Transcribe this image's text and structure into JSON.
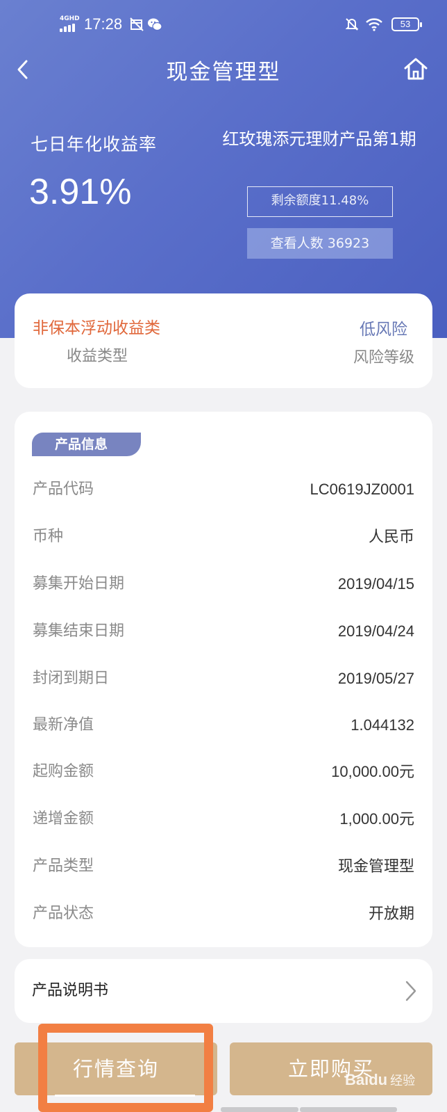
{
  "status_bar": {
    "network": "4GHD",
    "time": "17:28",
    "battery": "53",
    "icons": [
      "signal-icon",
      "calendar-off-icon",
      "wechat-icon",
      "mute-icon",
      "wifi-icon",
      "battery-icon"
    ]
  },
  "nav": {
    "title": "现金管理型",
    "back_icon": "back-chevron-icon",
    "home_icon": "home-icon"
  },
  "hero": {
    "rate_label": "七日年化收益率",
    "rate_value": "3.91%",
    "product_name": "红玫瑰添元理财产品第1期",
    "quota": "剩余额度11.48%",
    "viewers": "查看人数 36923"
  },
  "risk_card": {
    "return_type": "非保本浮动收益类",
    "return_type_label": "收益类型",
    "risk_level": "低风险",
    "risk_level_label": "风险等级"
  },
  "info_card": {
    "tab": "产品信息",
    "rows": [
      {
        "k": "产品代码",
        "v": "LC0619JZ0001"
      },
      {
        "k": "币种",
        "v": "人民币"
      },
      {
        "k": "募集开始日期",
        "v": "2019/04/15"
      },
      {
        "k": "募集结束日期",
        "v": "2019/04/24"
      },
      {
        "k": "封闭到期日",
        "v": "2019/05/27"
      },
      {
        "k": "最新净值",
        "v": "1.044132"
      },
      {
        "k": "起购金额",
        "v": "10,000.00元"
      },
      {
        "k": "递增金额",
        "v": "1,000.00元"
      },
      {
        "k": "产品类型",
        "v": "现金管理型"
      },
      {
        "k": "产品状态",
        "v": "开放期"
      }
    ]
  },
  "manual": {
    "label": "产品说明书",
    "icon": "chevron-right-icon"
  },
  "actions": {
    "market": "行情查询",
    "buy": "立即购买"
  },
  "watermark": {
    "brand": "Baidu",
    "suffix": "经验"
  },
  "colors": {
    "hero_gradient": [
      "#6a80d0",
      "#4a5fc0"
    ],
    "button": "#d4b68d",
    "highlight": "#f27f43",
    "return_type": "#e0673a",
    "risk_level": "#6778b5",
    "tab": "#7884c0"
  }
}
